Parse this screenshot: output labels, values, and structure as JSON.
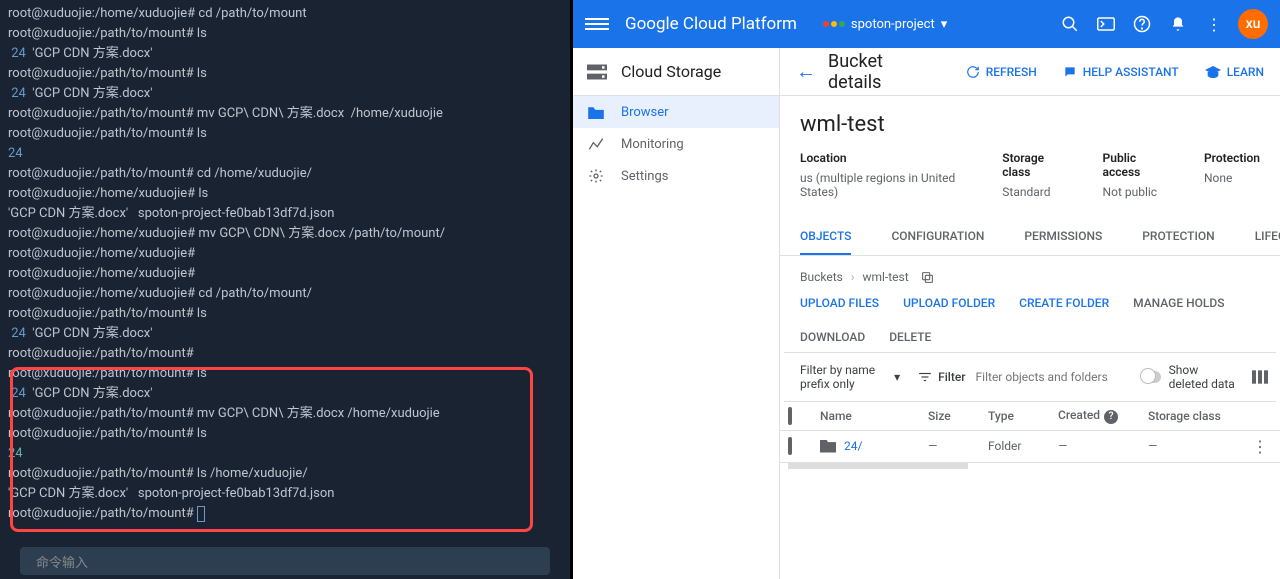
{
  "terminal": {
    "lines": [
      {
        "text": "root@xuduojie:/home/xuduojie# cd /path/to/mount"
      },
      {
        "text": "root@xuduojie:/path/to/mount# ls"
      },
      {
        "segments": [
          {
            "text": " 24",
            "class": "term-blue"
          },
          {
            "text": "  'GCP CDN 方案.docx'"
          }
        ]
      },
      {
        "text": "root@xuduojie:/path/to/mount# ls"
      },
      {
        "segments": [
          {
            "text": " 24",
            "class": "term-blue"
          },
          {
            "text": "  'GCP CDN 方案.docx'"
          }
        ]
      },
      {
        "text": "root@xuduojie:/path/to/mount# mv GCP\\ CDN\\ 方案.docx  /home/xuduojie"
      },
      {
        "text": "root@xuduojie:/path/to/mount# ls"
      },
      {
        "segments": [
          {
            "text": "24",
            "class": "term-blue"
          }
        ]
      },
      {
        "text": "root@xuduojie:/path/to/mount# cd /home/xuduojie/"
      },
      {
        "text": "root@xuduojie:/home/xuduojie# ls"
      },
      {
        "text": "'GCP CDN 方案.docx'   spoton-project-fe0bab13df7d.json"
      },
      {
        "text": "root@xuduojie:/home/xuduojie# mv GCP\\ CDN\\ 方案.docx /path/to/mount/"
      },
      {
        "text": "root@xuduojie:/home/xuduojie#"
      },
      {
        "text": "root@xuduojie:/home/xuduojie#"
      },
      {
        "text": "root@xuduojie:/home/xuduojie# cd /path/to/mount/"
      },
      {
        "text": "root@xuduojie:/path/to/mount# ls"
      },
      {
        "segments": [
          {
            "text": " 24",
            "class": "term-blue"
          },
          {
            "text": "  'GCP CDN 方案.docx'"
          }
        ]
      },
      {
        "text": "root@xuduojie:/path/to/mount#"
      },
      {
        "text": "root@xuduojie:/path/to/mount# ls"
      },
      {
        "segments": [
          {
            "text": " 24",
            "class": "term-blue"
          },
          {
            "text": "  'GCP CDN 方案.docx'"
          }
        ]
      },
      {
        "text": "root@xuduojie:/path/to/mount# mv GCP\\ CDN\\ 方案.docx /home/xuduojie"
      },
      {
        "text": "root@xuduojie:/path/to/mount# ls"
      },
      {
        "segments": [
          {
            "text": "24",
            "class": "term-cyan"
          }
        ]
      },
      {
        "text": "root@xuduojie:/path/to/mount# ls /home/xuduojie/"
      },
      {
        "text": "'GCP CDN 方案.docx'   spoton-project-fe0bab13df7d.json"
      },
      {
        "text": "root@xuduojie:/path/to/mount# ",
        "cursor": true
      }
    ],
    "footer": "命令输入"
  },
  "gcp": {
    "header": {
      "logo": "Google Cloud Platform",
      "project": "spoton-project",
      "avatar": "xu"
    },
    "sidebar": {
      "title": "Cloud Storage",
      "items": [
        {
          "label": "Browser",
          "active": true
        },
        {
          "label": "Monitoring"
        },
        {
          "label": "Settings"
        }
      ]
    },
    "main": {
      "title": "Bucket details",
      "actions": {
        "refresh": "REFRESH",
        "help": "HELP ASSISTANT",
        "learn": "LEARN"
      }
    },
    "bucket": {
      "name": "wml-test",
      "meta": {
        "location_label": "Location",
        "location_value": "us (multiple regions in United States)",
        "storage_label": "Storage class",
        "storage_value": "Standard",
        "access_label": "Public access",
        "access_value": "Not public",
        "protection_label": "Protection",
        "protection_value": "None"
      }
    },
    "tabs": [
      "OBJECTS",
      "CONFIGURATION",
      "PERMISSIONS",
      "PROTECTION",
      "LIFECYCLE"
    ],
    "breadcrumb": {
      "root": "Buckets",
      "current": "wml-test"
    },
    "bucket_actions": {
      "upload_files": "UPLOAD FILES",
      "upload_folder": "UPLOAD FOLDER",
      "create_folder": "CREATE FOLDER",
      "manage_holds": "MANAGE HOLDS",
      "download": "DOWNLOAD",
      "delete": "DELETE"
    },
    "filter": {
      "prefix_label": "Filter by name prefix only",
      "filter_label": "Filter",
      "placeholder": "Filter objects and folders",
      "show_deleted": "Show deleted data"
    },
    "table": {
      "headers": {
        "name": "Name",
        "size": "Size",
        "type": "Type",
        "created": "Created",
        "storage": "Storage class"
      },
      "rows": [
        {
          "name": "24/",
          "size": "—",
          "type": "Folder",
          "created": "—",
          "storage": "—"
        }
      ]
    }
  }
}
